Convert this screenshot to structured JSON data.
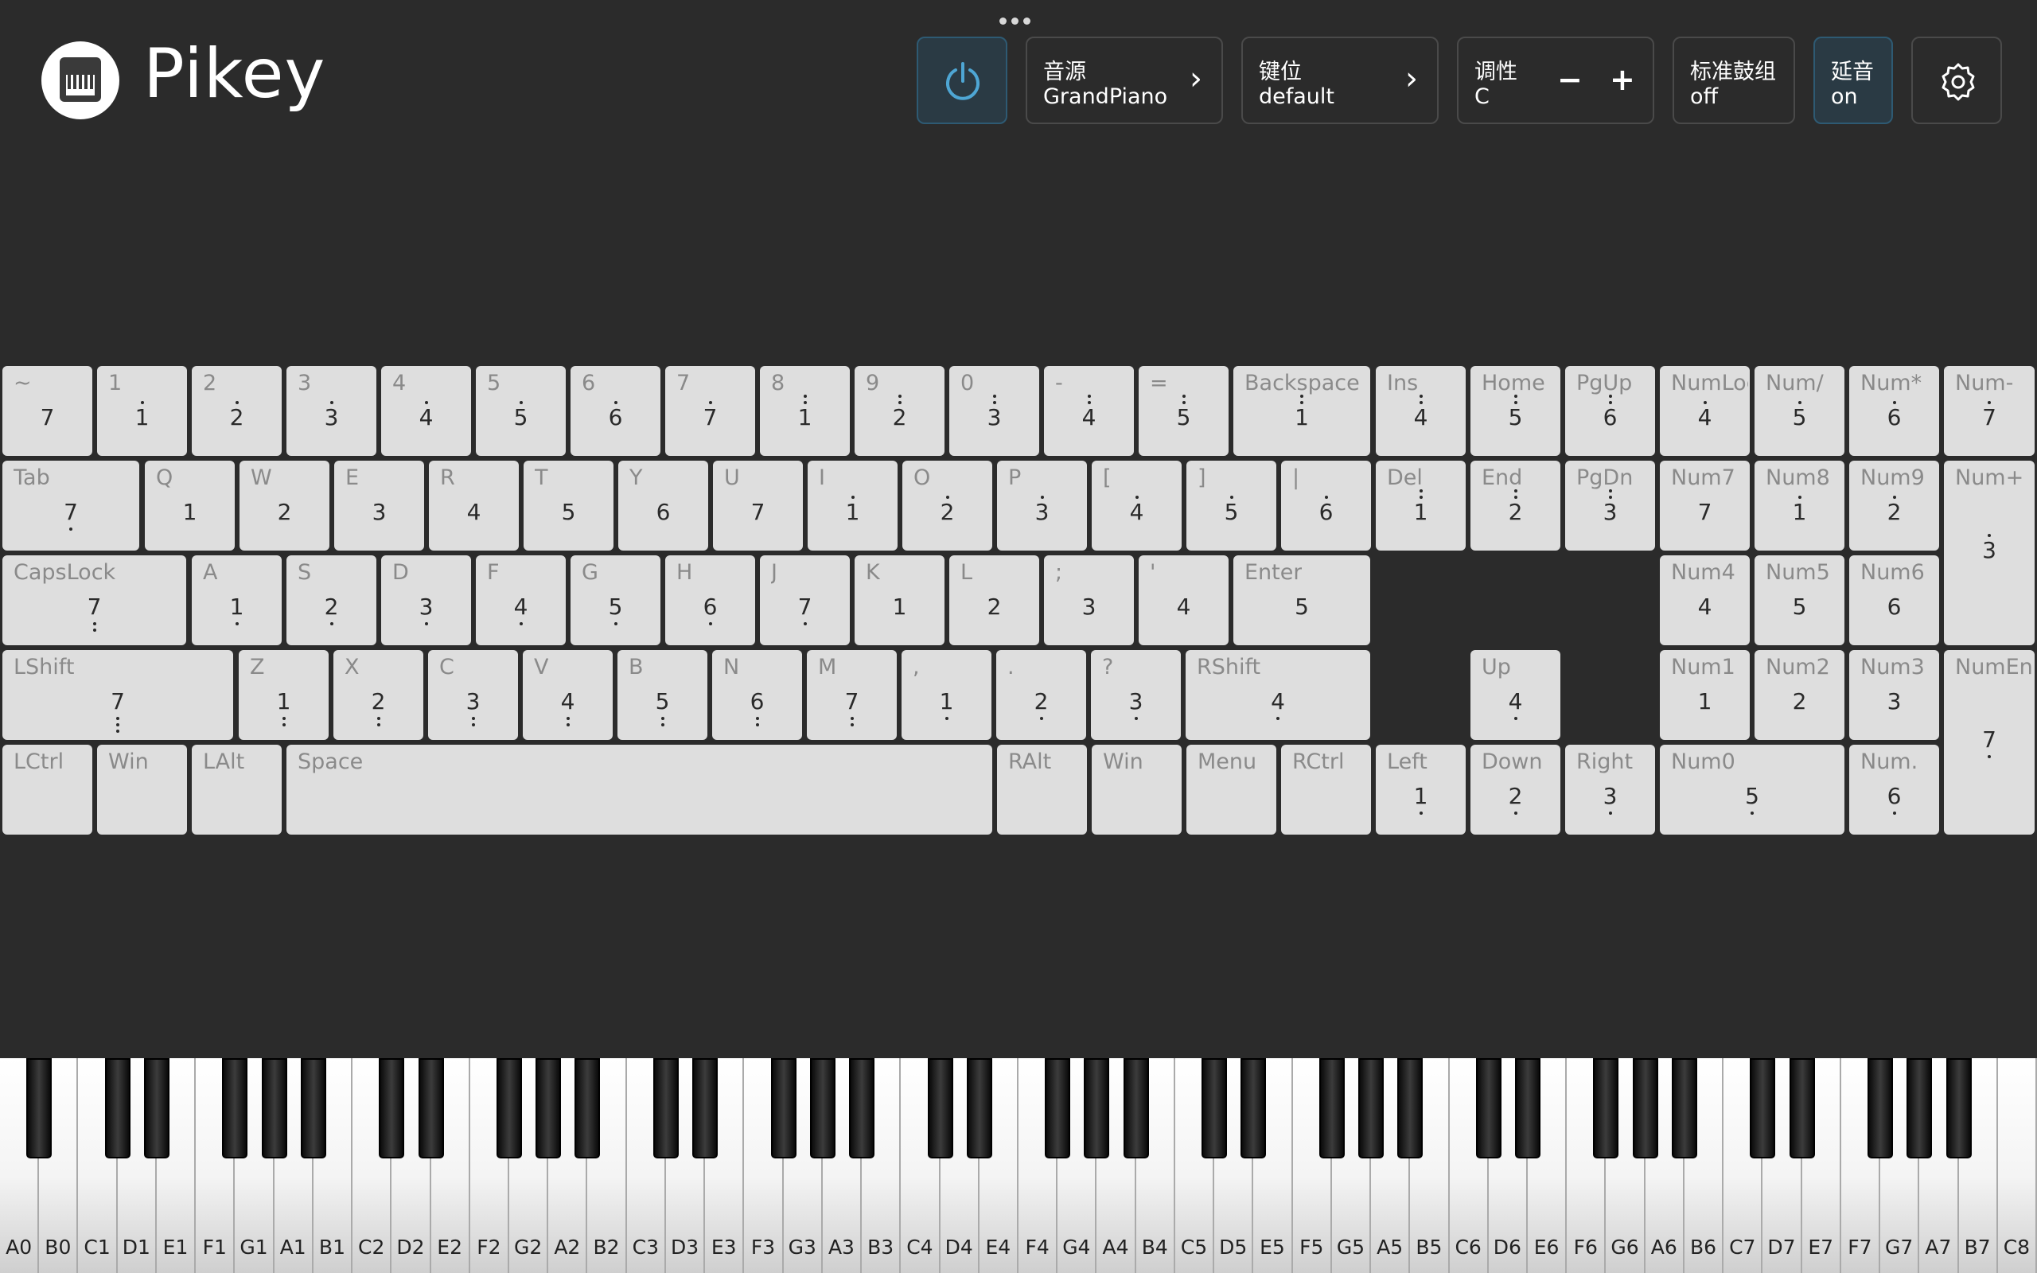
{
  "app": {
    "title": "Pikey"
  },
  "toolbar": {
    "sound": {
      "label": "音源",
      "value": "GrandPiano"
    },
    "keymap": {
      "label": "键位",
      "value": "default"
    },
    "tonality": {
      "label": "调性",
      "value": "C",
      "minus": "−",
      "plus": "+"
    },
    "drums": {
      "label": "标准鼓组",
      "value": "off"
    },
    "sustain": {
      "label": "延音",
      "value": "on"
    }
  },
  "keyboard": {
    "rows": [
      [
        {
          "label": "~",
          "note": "7",
          "dots": "none"
        },
        {
          "label": "1",
          "note": "1",
          "dots": "top1"
        },
        {
          "label": "2",
          "note": "2",
          "dots": "top1"
        },
        {
          "label": "3",
          "note": "3",
          "dots": "top1"
        },
        {
          "label": "4",
          "note": "4",
          "dots": "top1"
        },
        {
          "label": "5",
          "note": "5",
          "dots": "top1"
        },
        {
          "label": "6",
          "note": "6",
          "dots": "top1"
        },
        {
          "label": "7",
          "note": "7",
          "dots": "top1"
        },
        {
          "label": "8",
          "note": "1",
          "dots": "top2"
        },
        {
          "label": "9",
          "note": "2",
          "dots": "top2"
        },
        {
          "label": "0",
          "note": "3",
          "dots": "top2"
        },
        {
          "label": "-",
          "note": "4",
          "dots": "top2"
        },
        {
          "label": "=",
          "note": "5",
          "dots": "top2"
        },
        {
          "label": "Backspace",
          "note": "1",
          "dots": "top2"
        },
        {
          "label": "Ins",
          "note": "4",
          "dots": "top2"
        },
        {
          "label": "Home",
          "note": "5",
          "dots": "top2"
        },
        {
          "label": "PgUp",
          "note": "6",
          "dots": "top2"
        },
        {
          "label": "NumLock",
          "note": "4",
          "dots": "top1"
        },
        {
          "label": "Num/",
          "note": "5",
          "dots": "top1"
        },
        {
          "label": "Num*",
          "note": "6",
          "dots": "top1"
        },
        {
          "label": "Num-",
          "note": "7",
          "dots": "top1"
        }
      ],
      [
        {
          "label": "Tab",
          "note": "7",
          "dots": "bot1"
        },
        {
          "label": "Q",
          "note": "1",
          "dots": "none"
        },
        {
          "label": "W",
          "note": "2",
          "dots": "none"
        },
        {
          "label": "E",
          "note": "3",
          "dots": "none"
        },
        {
          "label": "R",
          "note": "4",
          "dots": "none"
        },
        {
          "label": "T",
          "note": "5",
          "dots": "none"
        },
        {
          "label": "Y",
          "note": "6",
          "dots": "none"
        },
        {
          "label": "U",
          "note": "7",
          "dots": "none"
        },
        {
          "label": "I",
          "note": "1",
          "dots": "top1"
        },
        {
          "label": "O",
          "note": "2",
          "dots": "top1"
        },
        {
          "label": "P",
          "note": "3",
          "dots": "top1"
        },
        {
          "label": "[",
          "note": "4",
          "dots": "top1"
        },
        {
          "label": "]",
          "note": "5",
          "dots": "top1"
        },
        {
          "label": "|",
          "note": "6",
          "dots": "top1"
        },
        {
          "label": "Del",
          "note": "1",
          "dots": "top2"
        },
        {
          "label": "End",
          "note": "2",
          "dots": "top2"
        },
        {
          "label": "PgDn",
          "note": "3",
          "dots": "top2"
        },
        {
          "label": "Num7",
          "note": "7",
          "dots": "none"
        },
        {
          "label": "Num8",
          "note": "1",
          "dots": "top1"
        },
        {
          "label": "Num9",
          "note": "2",
          "dots": "top1"
        },
        {
          "label": "Num+",
          "note": "3",
          "dots": "top1"
        }
      ],
      [
        {
          "label": "CapsLock",
          "note": "7",
          "dots": "bot2"
        },
        {
          "label": "A",
          "note": "1",
          "dots": "bot1"
        },
        {
          "label": "S",
          "note": "2",
          "dots": "bot1"
        },
        {
          "label": "D",
          "note": "3",
          "dots": "bot1"
        },
        {
          "label": "F",
          "note": "4",
          "dots": "bot1"
        },
        {
          "label": "G",
          "note": "5",
          "dots": "bot1"
        },
        {
          "label": "H",
          "note": "6",
          "dots": "bot1"
        },
        {
          "label": "J",
          "note": "7",
          "dots": "bot1"
        },
        {
          "label": "K",
          "note": "1",
          "dots": "none"
        },
        {
          "label": "L",
          "note": "2",
          "dots": "none"
        },
        {
          "label": ";",
          "note": "3",
          "dots": "none"
        },
        {
          "label": "'",
          "note": "4",
          "dots": "none"
        },
        {
          "label": "Enter",
          "note": "5",
          "dots": "none"
        },
        {
          "label": "Num4",
          "note": "4",
          "dots": "none"
        },
        {
          "label": "Num5",
          "note": "5",
          "dots": "none"
        },
        {
          "label": "Num6",
          "note": "6",
          "dots": "none"
        }
      ],
      [
        {
          "label": "LShift",
          "note": "7",
          "dots": "bot3"
        },
        {
          "label": "Z",
          "note": "1",
          "dots": "bot2"
        },
        {
          "label": "X",
          "note": "2",
          "dots": "bot2"
        },
        {
          "label": "C",
          "note": "3",
          "dots": "bot2"
        },
        {
          "label": "V",
          "note": "4",
          "dots": "bot2"
        },
        {
          "label": "B",
          "note": "5",
          "dots": "bot2"
        },
        {
          "label": "N",
          "note": "6",
          "dots": "bot2"
        },
        {
          "label": "M",
          "note": "7",
          "dots": "bot2"
        },
        {
          "label": ",",
          "note": "1",
          "dots": "bot1"
        },
        {
          "label": ".",
          "note": "2",
          "dots": "bot1"
        },
        {
          "label": "?",
          "note": "3",
          "dots": "bot1"
        },
        {
          "label": "RShift",
          "note": "4",
          "dots": "bot1"
        },
        {
          "label": "Up",
          "note": "4",
          "dots": "bot1"
        },
        {
          "label": "Num1",
          "note": "1",
          "dots": "none"
        },
        {
          "label": "Num2",
          "note": "2",
          "dots": "none"
        },
        {
          "label": "Num3",
          "note": "3",
          "dots": "none"
        },
        {
          "label": "NumEnter",
          "note": "7",
          "dots": "bot1"
        }
      ],
      [
        {
          "label": "LCtrl",
          "note": "",
          "dots": "none"
        },
        {
          "label": "Win",
          "note": "",
          "dots": "none"
        },
        {
          "label": "LAlt",
          "note": "",
          "dots": "none"
        },
        {
          "label": "Space",
          "note": "",
          "dots": "none"
        },
        {
          "label": "RAlt",
          "note": "",
          "dots": "none"
        },
        {
          "label": "Win",
          "note": "",
          "dots": "none"
        },
        {
          "label": "Menu",
          "note": "",
          "dots": "none"
        },
        {
          "label": "RCtrl",
          "note": "",
          "dots": "none"
        },
        {
          "label": "Left",
          "note": "1",
          "dots": "bot1"
        },
        {
          "label": "Down",
          "note": "2",
          "dots": "bot1"
        },
        {
          "label": "Right",
          "note": "3",
          "dots": "bot1"
        },
        {
          "label": "Num0",
          "note": "5",
          "dots": "bot1"
        },
        {
          "label": "Num.",
          "note": "6",
          "dots": "bot1"
        }
      ]
    ]
  },
  "piano": {
    "white_keys": [
      "A0",
      "B0",
      "C1",
      "D1",
      "E1",
      "F1",
      "G1",
      "A1",
      "B1",
      "C2",
      "D2",
      "E2",
      "F2",
      "G2",
      "A2",
      "B2",
      "C3",
      "D3",
      "E3",
      "F3",
      "G3",
      "A3",
      "B3",
      "C4",
      "D4",
      "E4",
      "F4",
      "G4",
      "A4",
      "B4",
      "C5",
      "D5",
      "E5",
      "F5",
      "G5",
      "A5",
      "B5",
      "C6",
      "D6",
      "E6",
      "F6",
      "G6",
      "A6",
      "B6",
      "C7",
      "D7",
      "E7",
      "F7",
      "G7",
      "A7",
      "B7",
      "C8"
    ]
  }
}
